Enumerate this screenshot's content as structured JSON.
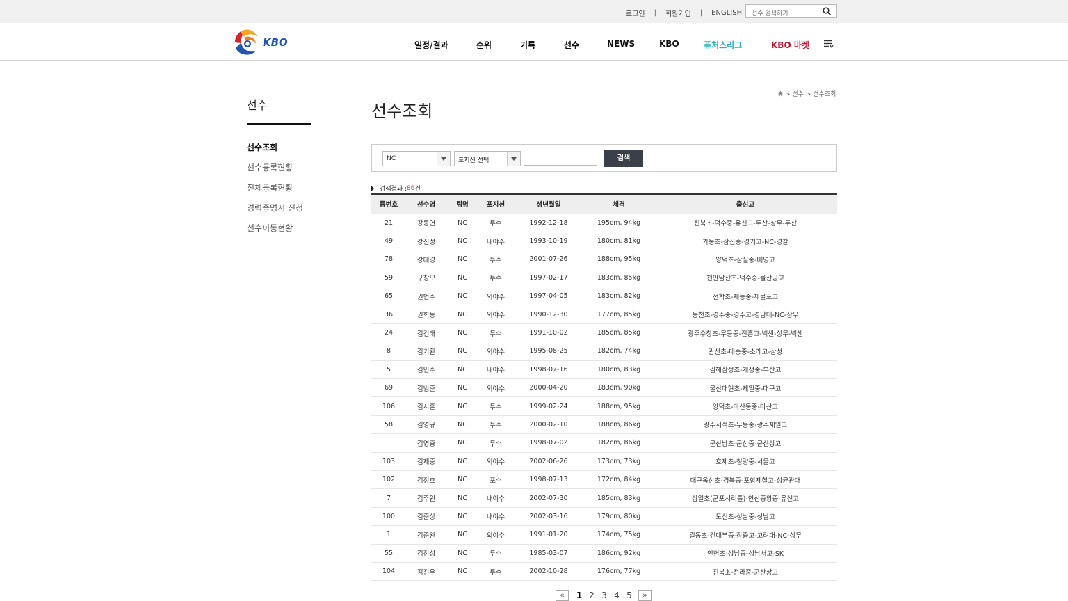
{
  "top_links": {
    "login": "로그인",
    "join": "회원가입",
    "english": "ENGLISH",
    "sep": "|"
  },
  "top_search": {
    "placeholder": "선수 검색하기"
  },
  "logo": {
    "text": "KBO"
  },
  "nav": [
    {
      "label": "일정/결과",
      "color": "#111111"
    },
    {
      "label": "순위",
      "color": "#111111"
    },
    {
      "label": "기록",
      "color": "#111111"
    },
    {
      "label": "선수",
      "color": "#111111"
    },
    {
      "label": "NEWS",
      "color": "#111111"
    },
    {
      "label": "KBO",
      "color": "#111111"
    },
    {
      "label": "퓨처스리그",
      "color": "#1ab3b8"
    },
    {
      "label": "KBO 마켓",
      "color": "#c8102e"
    }
  ],
  "side": {
    "title": "선수",
    "items": [
      {
        "label": "선수조회",
        "active": true
      },
      {
        "label": "선수등록현황",
        "active": false
      },
      {
        "label": "전체등록현황",
        "active": false
      },
      {
        "label": "경력증명서 신청",
        "active": false
      },
      {
        "label": "선수이동현황",
        "active": false
      }
    ]
  },
  "breadcrumb": "> 선수 > 선수조회",
  "page_title": "선수조회",
  "filter": {
    "team": "NC",
    "position": "포지션 선택",
    "search_label": "검색"
  },
  "result": {
    "label": "검색결과 : ",
    "count": "86",
    "unit": "건"
  },
  "table": {
    "headers": [
      "등번호",
      "선수명",
      "팀명",
      "포지션",
      "생년월일",
      "체격",
      "출신교"
    ],
    "rows": [
      [
        "21",
        "강동연",
        "NC",
        "투수",
        "1992-12-18",
        "195cm, 94kg",
        "진북초-덕수중-유신고-두산-상무-두산"
      ],
      [
        "49",
        "강진성",
        "NC",
        "내야수",
        "1993-10-19",
        "180cm, 81kg",
        "가동초-잠신중-경기고-NC-경찰"
      ],
      [
        "78",
        "강태경",
        "NC",
        "투수",
        "2001-07-26",
        "188cm, 95kg",
        "양덕초-잠실중-배명고"
      ],
      [
        "59",
        "구창모",
        "NC",
        "투수",
        "1997-02-17",
        "183cm, 85kg",
        "천안남산초-덕수중-울산공고"
      ],
      [
        "65",
        "권법수",
        "NC",
        "외야수",
        "1997-04-05",
        "183cm, 82kg",
        "선학초-재능중-제물포고"
      ],
      [
        "36",
        "권희동",
        "NC",
        "외야수",
        "1990-12-30",
        "177cm, 85kg",
        "동천초-경주중-경주고-경남대-NC-상무"
      ],
      [
        "24",
        "김건태",
        "NC",
        "투수",
        "1991-10-02",
        "185cm, 85kg",
        "광주수창초-무등중-진흥고-넥센-상무-넥센"
      ],
      [
        "8",
        "김기환",
        "NC",
        "외야수",
        "1995-08-25",
        "182cm, 74kg",
        "관산초-대송중-소래고-삼성"
      ],
      [
        "5",
        "김민수",
        "NC",
        "내야수",
        "1998-07-16",
        "180cm, 83kg",
        "김해삼성초-개성중-부산고"
      ],
      [
        "69",
        "김범준",
        "NC",
        "외야수",
        "2000-04-20",
        "183cm, 90kg",
        "울산대현초-제일중-대구고"
      ],
      [
        "106",
        "김시훈",
        "NC",
        "투수",
        "1999-02-24",
        "188cm, 95kg",
        "양덕초-마산동중-마산고"
      ],
      [
        "58",
        "김영규",
        "NC",
        "투수",
        "2000-02-10",
        "188cm, 86kg",
        "광주서석초-무등중-광주제일고"
      ],
      [
        "",
        "김영충",
        "NC",
        "투수",
        "1998-07-02",
        "182cm, 86kg",
        "군산남초-군산중-군산상고"
      ],
      [
        "103",
        "김재중",
        "NC",
        "외야수",
        "2002-06-26",
        "173cm, 73kg",
        "효제초-청량중-서울고"
      ],
      [
        "102",
        "김정호",
        "NC",
        "포수",
        "1998-07-13",
        "172cm, 84kg",
        "대구옥산초-경북중-포항제철고-성균관대"
      ],
      [
        "7",
        "김주원",
        "NC",
        "내야수",
        "2002-07-30",
        "185cm, 83kg",
        "삼일초(군포시리틀)-안산중앙중-유신고"
      ],
      [
        "100",
        "김준상",
        "NC",
        "내야수",
        "2002-03-16",
        "179cm, 80kg",
        "도신초-성남중-성남고"
      ],
      [
        "1",
        "김준완",
        "NC",
        "외야수",
        "1991-01-20",
        "174cm, 75kg",
        "길동초-건대부중-장충고-고려대-NC-상무"
      ],
      [
        "55",
        "김진성",
        "NC",
        "투수",
        "1985-03-07",
        "186cm, 92kg",
        "인헌초-성남중-성남서고-SK"
      ],
      [
        "104",
        "김진우",
        "NC",
        "투수",
        "2002-10-28",
        "176cm, 77kg",
        "진북초-전라중-군산상고"
      ]
    ]
  },
  "paging": {
    "prev": "«",
    "next": "»",
    "pages": [
      "1",
      "2",
      "3",
      "4",
      "5"
    ],
    "current": "1"
  }
}
